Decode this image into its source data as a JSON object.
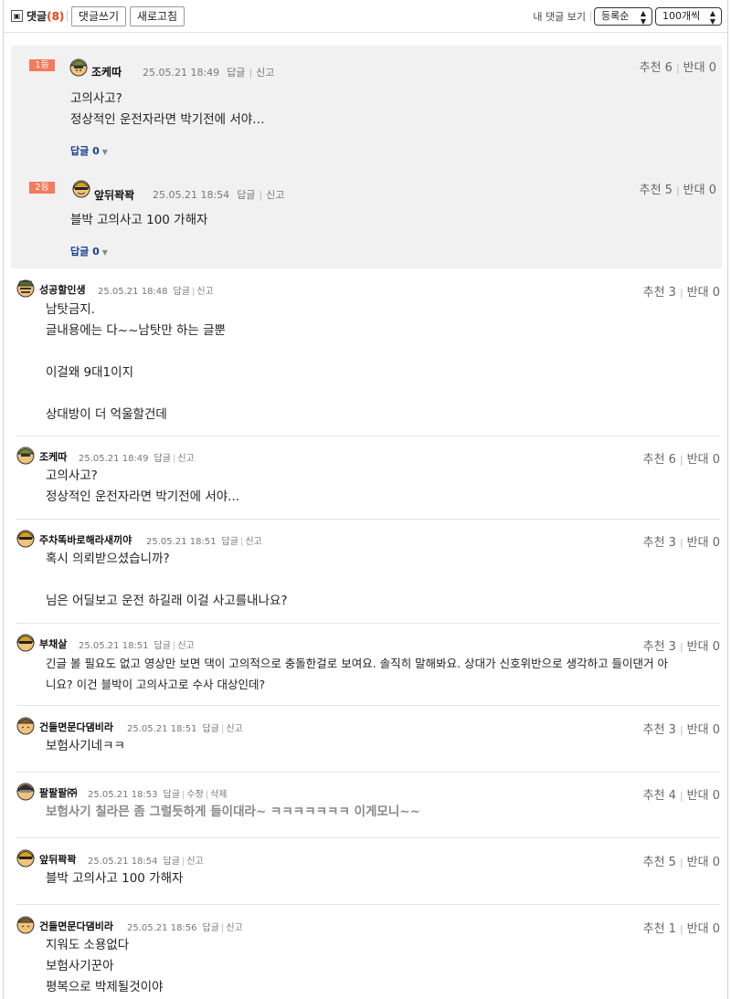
{
  "toolbar": {
    "toggle_icon": "▣",
    "title": "댓글",
    "count": "(8)",
    "write_label": "댓글쓰기",
    "refresh_label": "새로고침",
    "my_comments": "내 댓글 보기",
    "sort_value": "등록순",
    "per_page_value": "100개씩"
  },
  "best": [
    {
      "rank": "1등",
      "nick": "조케따",
      "date": "25.05.21 18:49",
      "reply": "답글",
      "report": "신고",
      "lines": [
        "고의사고?",
        "정상적인 운전자라면 박기전에 서야…"
      ],
      "reply_count": "답글 0",
      "up": "추천 6",
      "down": "반대 0"
    },
    {
      "rank": "2등",
      "nick": "앞뒤꽉꽉",
      "date": "25.05.21 18:54",
      "reply": "답글",
      "report": "신고",
      "lines": [
        "블박 고의사고 100 가해자"
      ],
      "reply_count": "답글 0",
      "up": "추천 5",
      "down": "반대 0"
    }
  ],
  "comments": [
    {
      "nick": "성공할인생",
      "date": "25.05.21 18:48",
      "actions": [
        "답글",
        "신고"
      ],
      "lines": [
        "남탓금지.",
        "글내용에는 다~~남탓만 하는 글뿐",
        "",
        "이걸왜 9대1이지",
        "",
        "상대방이 더 억울할건데"
      ],
      "up": "추천 3",
      "down": "반대 0"
    },
    {
      "nick": "조케따",
      "date": "25.05.21 18:49",
      "actions": [
        "답글",
        "신고"
      ],
      "lines": [
        "고의사고?",
        "정상적인 운전자라면 박기전에 서야..."
      ],
      "up": "추천 6",
      "down": "반대 0"
    },
    {
      "nick": "주차똑바로해라새끼야",
      "date": "25.05.21 18:51",
      "actions": [
        "답글",
        "신고"
      ],
      "lines": [
        "혹시 의뢰받으셨습니까?",
        "",
        "님은 어딜보고 운전 하길래 이걸 사고를내나요?"
      ],
      "up": "추천 3",
      "down": "반대 0"
    },
    {
      "nick": "부채살",
      "date": "25.05.21 18:51",
      "actions": [
        "답글",
        "신고"
      ],
      "lines": [
        "긴글 볼 필요도 없고 영상만 보면 댁이 고의적으로 충돌한걸로 보여요. 솔직히 말해봐요. 상대가 신호위반으로 생각하고 들이댄거 아",
        "니요? 이건 블박이 고의사고로 수사 대상인데?"
      ],
      "up": "추천 3",
      "down": "반대 0"
    },
    {
      "nick": "건들면문다댐비라",
      "date": "25.05.21 18:51",
      "actions": [
        "답글",
        "신고"
      ],
      "lines": [
        "보험사기네ㅋㅋ"
      ],
      "up": "추천 3",
      "down": "반대 0"
    },
    {
      "nick": "팔팔팔㈜",
      "date": "25.05.21 18:53",
      "actions": [
        "답글",
        "수정",
        "삭제"
      ],
      "lines": [
        "보험사기 칠라믄 좀 그럴듯하게 들이대라~ ㅋㅋㅋㅋㅋㅋㅋ 이게모니~~"
      ],
      "up": "추천 4",
      "down": "반대 0"
    },
    {
      "nick": "앞뒤꽉꽉",
      "date": "25.05.21 18:54",
      "actions": [
        "답글",
        "신고"
      ],
      "lines": [
        "블박 고의사고 100 가해자"
      ],
      "up": "추천 5",
      "down": "반대 0"
    },
    {
      "nick": "건들면문다댐비라",
      "date": "25.05.21 18:56",
      "actions": [
        "답글",
        "신고"
      ],
      "lines": [
        "지워도 소용없다",
        "보험사기꾼아",
        "평복으로 박제될것이야"
      ],
      "up": "추천 1",
      "down": "반대 0"
    }
  ]
}
